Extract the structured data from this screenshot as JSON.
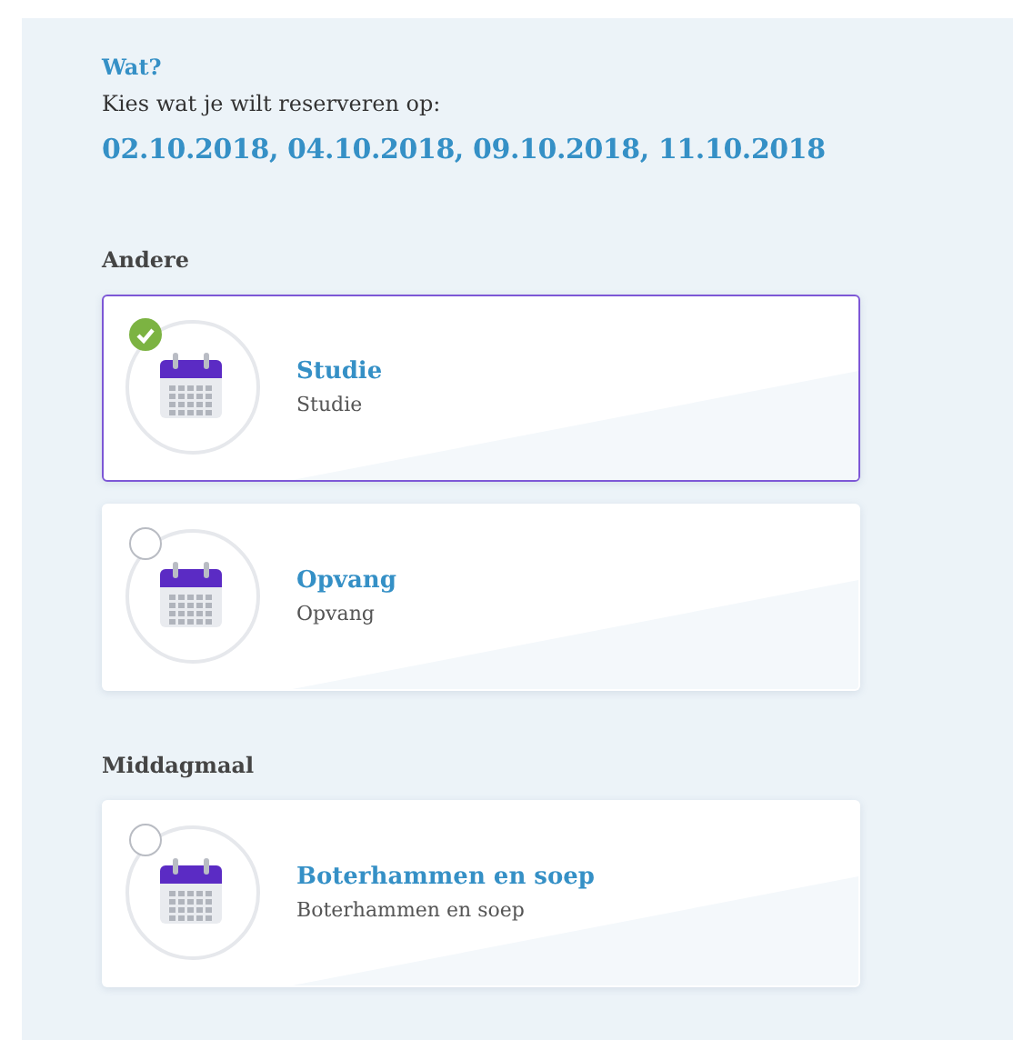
{
  "heading": "Wat?",
  "instruction": "Kies wat je wilt reserveren op:",
  "dates": "02.10.2018, 04.10.2018, 09.10.2018, 11.10.2018",
  "groups": [
    {
      "title": "Andere",
      "options": [
        {
          "title": "Studie",
          "subtitle": "Studie",
          "selected": true
        },
        {
          "title": "Opvang",
          "subtitle": "Opvang",
          "selected": false
        }
      ]
    },
    {
      "title": "Middagmaal",
      "options": [
        {
          "title": "Boterhammen en soep",
          "subtitle": "Boterhammen en soep",
          "selected": false
        }
      ]
    }
  ]
}
